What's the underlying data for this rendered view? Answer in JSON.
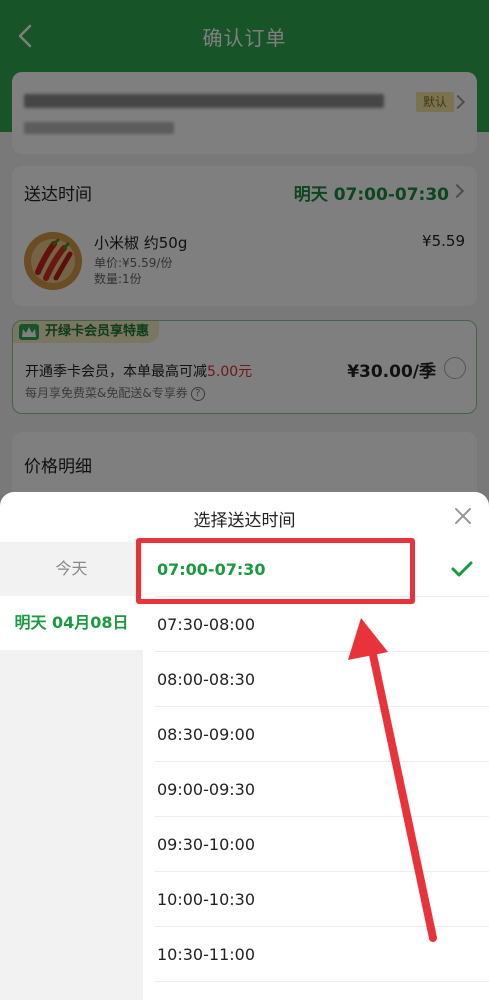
{
  "header": {
    "title": "确认订单"
  },
  "address": {
    "default_badge": "默认"
  },
  "delivery": {
    "label": "送达时间",
    "time": "明天 07:00-07:30"
  },
  "product": {
    "name": "小米椒 约50g",
    "unit_price": "单价:¥5.59/份",
    "quantity": "数量:1份",
    "price": "¥5.59"
  },
  "member": {
    "badge": "开绿卡会员享特惠",
    "main_prefix": "开通季卡会员，本单最高可减",
    "discount": "5.00元",
    "sub": "每月享免费菜&免配送&专享券",
    "price": "¥30.00/季"
  },
  "price_detail": {
    "label": "价格明细"
  },
  "sheet": {
    "title": "选择送达时间",
    "days": [
      {
        "label": "今天"
      },
      {
        "label": "明天 04月08日"
      }
    ],
    "slots": [
      {
        "label": "07:00-07:30"
      },
      {
        "label": "07:30-08:00"
      },
      {
        "label": "08:00-08:30"
      },
      {
        "label": "08:30-09:00"
      },
      {
        "label": "09:00-09:30"
      },
      {
        "label": "09:30-10:00"
      },
      {
        "label": "10:00-10:30"
      },
      {
        "label": "10:30-11:00"
      }
    ],
    "selected_slot": "07:00-07:30"
  },
  "colors": {
    "brand_green": "#2fa84f",
    "selected_green": "#1a9a3f",
    "annotation_red": "#e8333a",
    "discount_red": "#e0302f"
  }
}
